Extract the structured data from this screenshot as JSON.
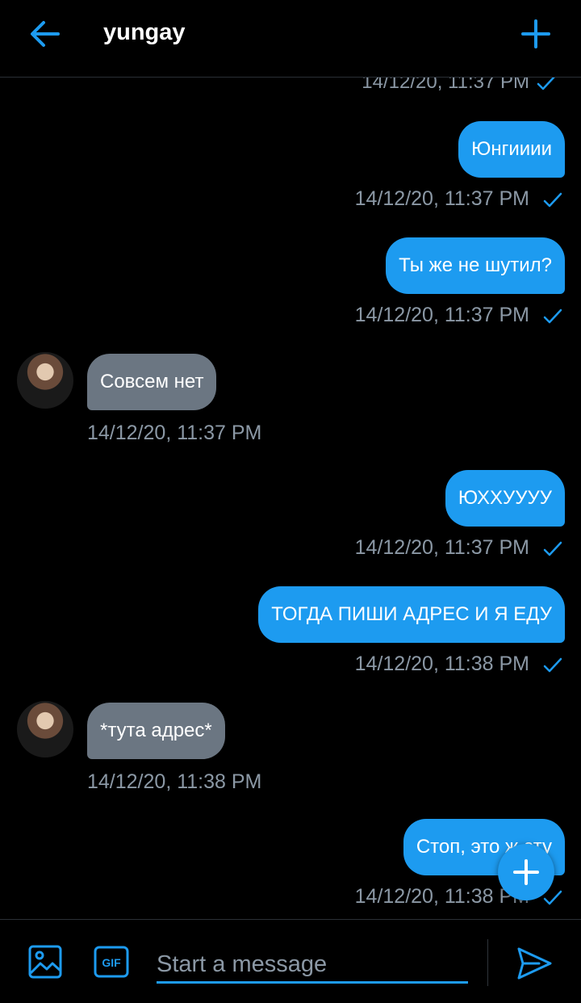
{
  "header": {
    "title": "yungay"
  },
  "composer": {
    "placeholder": "Start a message"
  },
  "colors": {
    "accent": "#1d9bf0",
    "incoming_bubble": "#6b7682",
    "timestamp": "#8b98a5",
    "background": "#000000"
  },
  "messages": [
    {
      "direction": "out",
      "text": "Юнгииии",
      "time": "14/12/20, 11:37 PM",
      "read": true
    },
    {
      "direction": "out",
      "text": "Ты же не шутил?",
      "time": "14/12/20, 11:37 PM",
      "read": true
    },
    {
      "direction": "in",
      "text": "Совсем нет",
      "time": "14/12/20, 11:37 PM"
    },
    {
      "direction": "out",
      "text": "ЮХХУУУУ",
      "time": "14/12/20, 11:37 PM",
      "read": true
    },
    {
      "direction": "out",
      "text": "ТОГДА ПИШИ АДРЕС И Я ЕДУ",
      "time": "14/12/20, 11:38 PM",
      "read": true
    },
    {
      "direction": "in",
      "text": "*тута адрес*",
      "time": "14/12/20, 11:38 PM"
    },
    {
      "direction": "out",
      "text": "Стоп, это ж сту",
      "time": "14/12/20, 11:38 PM",
      "read": true
    }
  ],
  "icons": {
    "back": "arrow-left-icon",
    "new": "plus-icon",
    "media": "image-icon",
    "gif": "gif-icon",
    "send": "send-icon",
    "read": "check-icon"
  }
}
